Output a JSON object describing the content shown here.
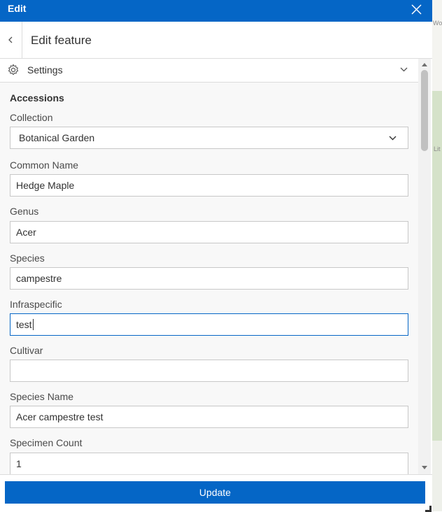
{
  "window": {
    "title": "Edit"
  },
  "header": {
    "title": "Edit feature"
  },
  "settings": {
    "label": "Settings"
  },
  "form": {
    "section_title": "Accessions",
    "fields": [
      {
        "label": "Collection",
        "value": "Botanical Garden",
        "type": "select"
      },
      {
        "label": "Common Name",
        "value": "Hedge Maple"
      },
      {
        "label": "Genus",
        "value": "Acer"
      },
      {
        "label": "Species",
        "value": "campestre"
      },
      {
        "label": "Infraspecific",
        "value": "test",
        "focused": true
      },
      {
        "label": "Cultivar",
        "value": ""
      },
      {
        "label": "Species Name",
        "value": "Acer campestre test"
      },
      {
        "label": "Specimen Count",
        "value": "1"
      }
    ]
  },
  "footer": {
    "update_label": "Update"
  },
  "map": {
    "label_top": "Wo",
    "label_mid": "Lit"
  },
  "colors": {
    "accent": "#0566c6",
    "border": "#c8c8c8",
    "panel_bg": "#f8f8f8"
  }
}
